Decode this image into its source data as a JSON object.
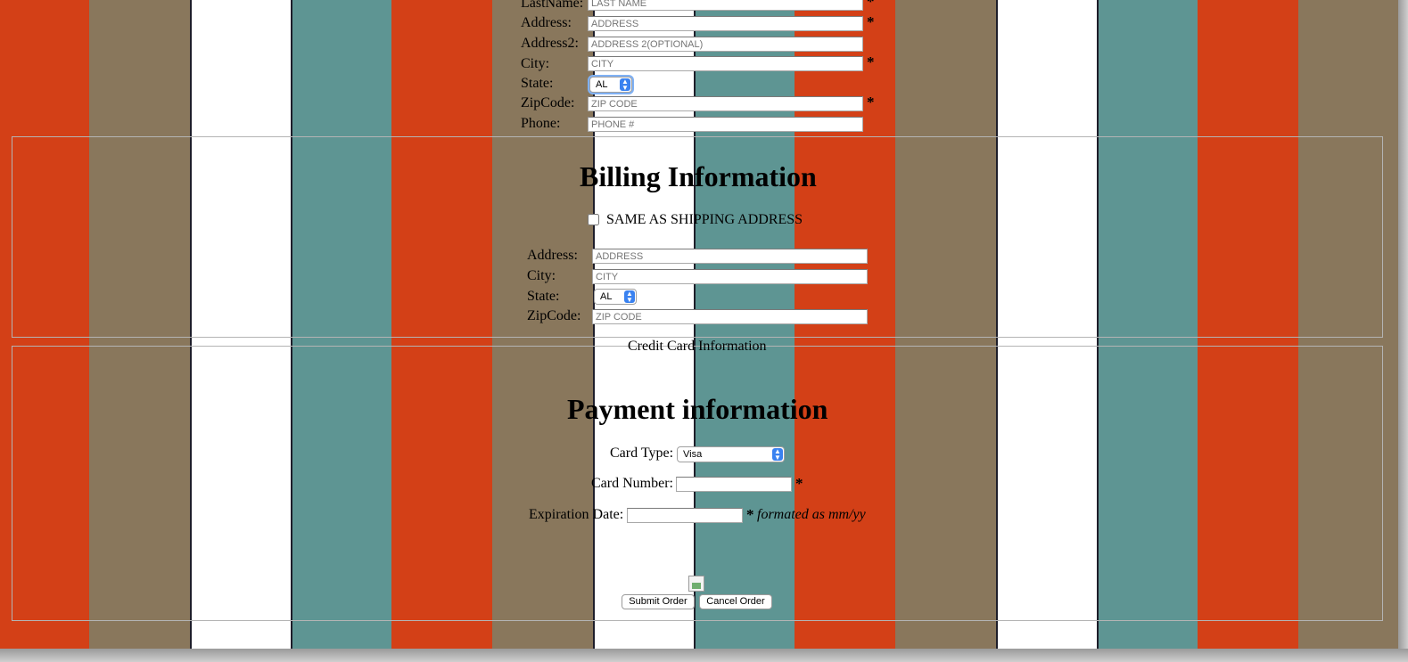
{
  "background_colors": [
    "#d34017",
    "#89775c",
    "#ffffff",
    "#5e9593",
    "#1e1e2a"
  ],
  "shipping": {
    "lastname_label": "LastName:",
    "lastname_placeholder": "LAST NAME",
    "address_label": "Address:",
    "address_placeholder": "ADDRESS",
    "address2_label": "Address2:",
    "address2_placeholder": "ADDRESS 2(OPTIONAL)",
    "city_label": "City:",
    "city_placeholder": "CITY",
    "state_label": "State:",
    "state_value": "AL",
    "zip_label": "ZipCode:",
    "zip_placeholder": "ZIP CODE",
    "phone_label": "Phone:",
    "phone_placeholder": "PHONE #",
    "required_mark": "*"
  },
  "billing": {
    "title": "Billing Information",
    "same_as_shipping_label": "SAME AS SHIPPING ADDRESS",
    "address_label": "Address:",
    "address_placeholder": "ADDRESS",
    "city_label": "City:",
    "city_placeholder": "CITY",
    "state_label": "State:",
    "state_value": "AL",
    "zip_label": "ZipCode:",
    "zip_placeholder": "ZIP CODE"
  },
  "payment": {
    "legend": "Credit Card Information",
    "title": "Payment information",
    "card_type_label": "Card Type:",
    "card_type_value": "Visa",
    "card_number_label": "Card Number:",
    "card_number_value": "",
    "expiration_label": "Expiration Date:",
    "expiration_value": "",
    "expiration_hint": "formated as mm/yy",
    "required_mark": "*"
  },
  "actions": {
    "submit_label": "Submit Order",
    "cancel_label": "Cancel Order"
  }
}
